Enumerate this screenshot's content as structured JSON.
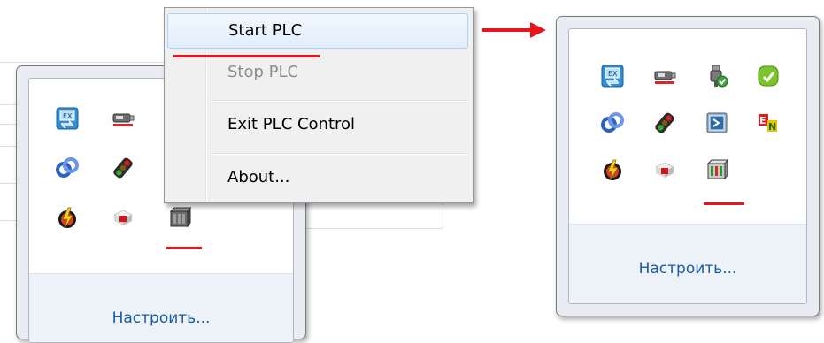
{
  "context_menu": {
    "items": [
      {
        "label": "Start PLC",
        "state": "highlighted"
      },
      {
        "label": "Stop PLC",
        "state": "disabled"
      },
      {
        "label": "Exit PLC Control",
        "state": "normal"
      },
      {
        "label": "About...",
        "state": "normal"
      }
    ]
  },
  "tray_left": {
    "customize_label": "Настроить...",
    "icons": [
      "xtrans-icon",
      "usb-drive-icon",
      "link-icon",
      "traffic-light-icon",
      "bolt-gear-icon",
      "red-cube-icon",
      "plc-stopped-icon"
    ]
  },
  "tray_right": {
    "customize_label": "Настроить...",
    "icons": [
      "xtrans-icon",
      "usb-drive-icon",
      "usb-plug-check-icon",
      "green-sync-icon",
      "link-icon",
      "traffic-light-icon",
      "terminal-icon",
      "en-keyboard-icon",
      "bolt-gear-icon",
      "red-cube-icon",
      "plc-running-icon"
    ]
  },
  "colors": {
    "highlight_underline": "#e8141b",
    "arrow": "#e8141b",
    "link_text": "#1c5aa0"
  }
}
